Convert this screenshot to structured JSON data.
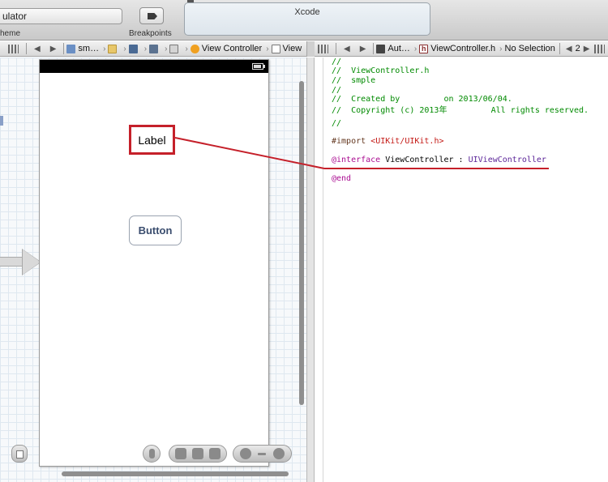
{
  "toolbar": {
    "scheme_text": "ulator",
    "scheme_label": "heme",
    "breakpoints_label": "Breakpoints",
    "activity_title": "Xcode"
  },
  "jumpbar_left": {
    "items": [
      "sm…",
      "View Controller",
      "View"
    ]
  },
  "jumpbar_right": {
    "related": "Aut…",
    "file": "ViewController.h",
    "selection": "No Selection",
    "counterpart_count": "2"
  },
  "storyboard": {
    "label_text": "Label",
    "button_text": "Button"
  },
  "code": {
    "lines": [
      "//",
      "//  ViewController.h",
      "//  smple",
      "//",
      "//  Created by         on 2013/06/04.",
      "//  Copyright (c) 2013年         All rights reserved.",
      "//"
    ],
    "import_directive": "#import",
    "import_target": "<UIKit/UIKit.h>",
    "interface_kw": "@interface",
    "interface_name": "ViewController : ",
    "superclass": "UIViewController",
    "end_kw": "@end"
  },
  "colors": {
    "annotation_red": "#c5202a",
    "button_text": "#3a4d6e",
    "comment_green": "#008a00",
    "keyword_purple": "#aa0d91"
  },
  "icons": [
    "grid-icon",
    "back-arrow-icon",
    "forward-arrow-icon",
    "project-icon",
    "folder-icon",
    "file-icon",
    "storyboard-icon",
    "view-controller-icon",
    "view-icon",
    "related-items-icon",
    "header-file-icon",
    "battery-icon",
    "breakpoint-arrow-icon"
  ]
}
